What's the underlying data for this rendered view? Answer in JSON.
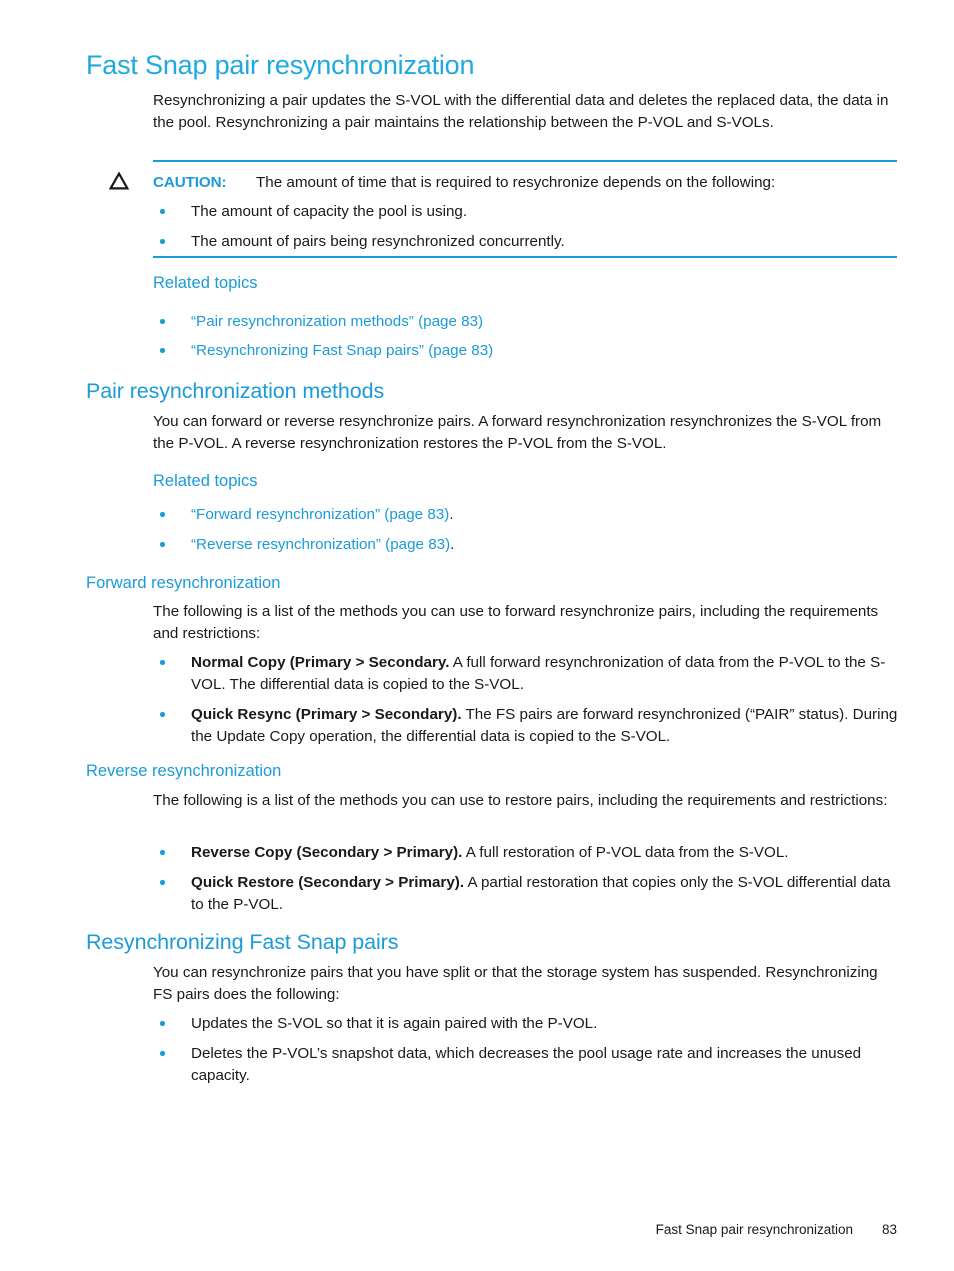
{
  "colors": {
    "heading_primary": "#1eaae0",
    "heading_secondary": "#1b9bd8",
    "link": "#1b9bd8",
    "rule": "#1b9bd8",
    "body_text": "#1a1a1a"
  },
  "sections": {
    "main_heading": "Fast Snap pair resynchronization",
    "intro_paragraph": "Resynchronizing a pair updates the S-VOL with the differential data and deletes the replaced data, the data in the pool. Resynchronizing a pair maintains the relationship between the P-VOL and S-VOLs.",
    "caution": {
      "icon": "caution-triangle-icon",
      "label": "CAUTION:",
      "text": "The amount of time that is required to resychronize depends on the following:",
      "bullets": [
        "The amount of capacity the pool is using.",
        "The amount of pairs being resynchronized concurrently."
      ]
    },
    "related_topics_1": {
      "heading": "Related topics",
      "links": [
        "“Pair resynchronization methods” (page 83)",
        "“Resynchronizing Fast Snap pairs” (page 83)"
      ]
    },
    "pair_methods": {
      "heading": "Pair resynchronization methods",
      "paragraph": "You can forward or reverse resynchronize pairs. A forward resynchronization resynchronizes the S-VOL from the P-VOL. A reverse resynchronization restores the P-VOL from the S-VOL.",
      "related_topics_heading": "Related topics",
      "links": [
        {
          "text": "“Forward resynchronization” (page 83)",
          "suffix": "."
        },
        {
          "text": "“Reverse resynchronization” (page 83)",
          "suffix": "."
        }
      ]
    },
    "forward": {
      "heading": "Forward resynchronization",
      "paragraph": "The following is a list of the methods you can use to forward resynchronize pairs, including the requirements and restrictions:",
      "bullets": [
        {
          "lead": "Normal Copy (Primary > Secondary.",
          "rest": " A full forward resynchronization of data from the P-VOL to the S-VOL. The differential data is copied to the S-VOL."
        },
        {
          "lead": "Quick Resync (Primary > Secondary).",
          "rest": " The FS pairs are forward resynchronized (“PAIR” status). During the Update Copy operation, the differential data is copied to the S-VOL."
        }
      ]
    },
    "reverse": {
      "heading": "Reverse resynchronization",
      "paragraph": "The following is a list of the methods you can use to restore pairs, including the requirements and restrictions:",
      "bullets": [
        {
          "lead": "Reverse Copy (Secondary > Primary).",
          "rest": " A full restoration of P-VOL data from the S-VOL."
        },
        {
          "lead": "Quick Restore (Secondary > Primary).",
          "rest": " A partial restoration that copies only the S-VOL differential data to the P-VOL."
        }
      ]
    },
    "resync_fs": {
      "heading": "Resynchronizing Fast Snap pairs",
      "paragraph": "You can resynchronize pairs that you have split or that the storage system has suspended. Resynchronizing FS pairs does the following:",
      "bullets": [
        "Updates the S-VOL so that it is again paired with the P-VOL.",
        "Deletes the P-VOL’s snapshot data, which decreases the pool usage rate and increases the unused capacity."
      ]
    }
  },
  "footer": {
    "title": "Fast Snap pair resynchronization",
    "page_number": "83"
  }
}
